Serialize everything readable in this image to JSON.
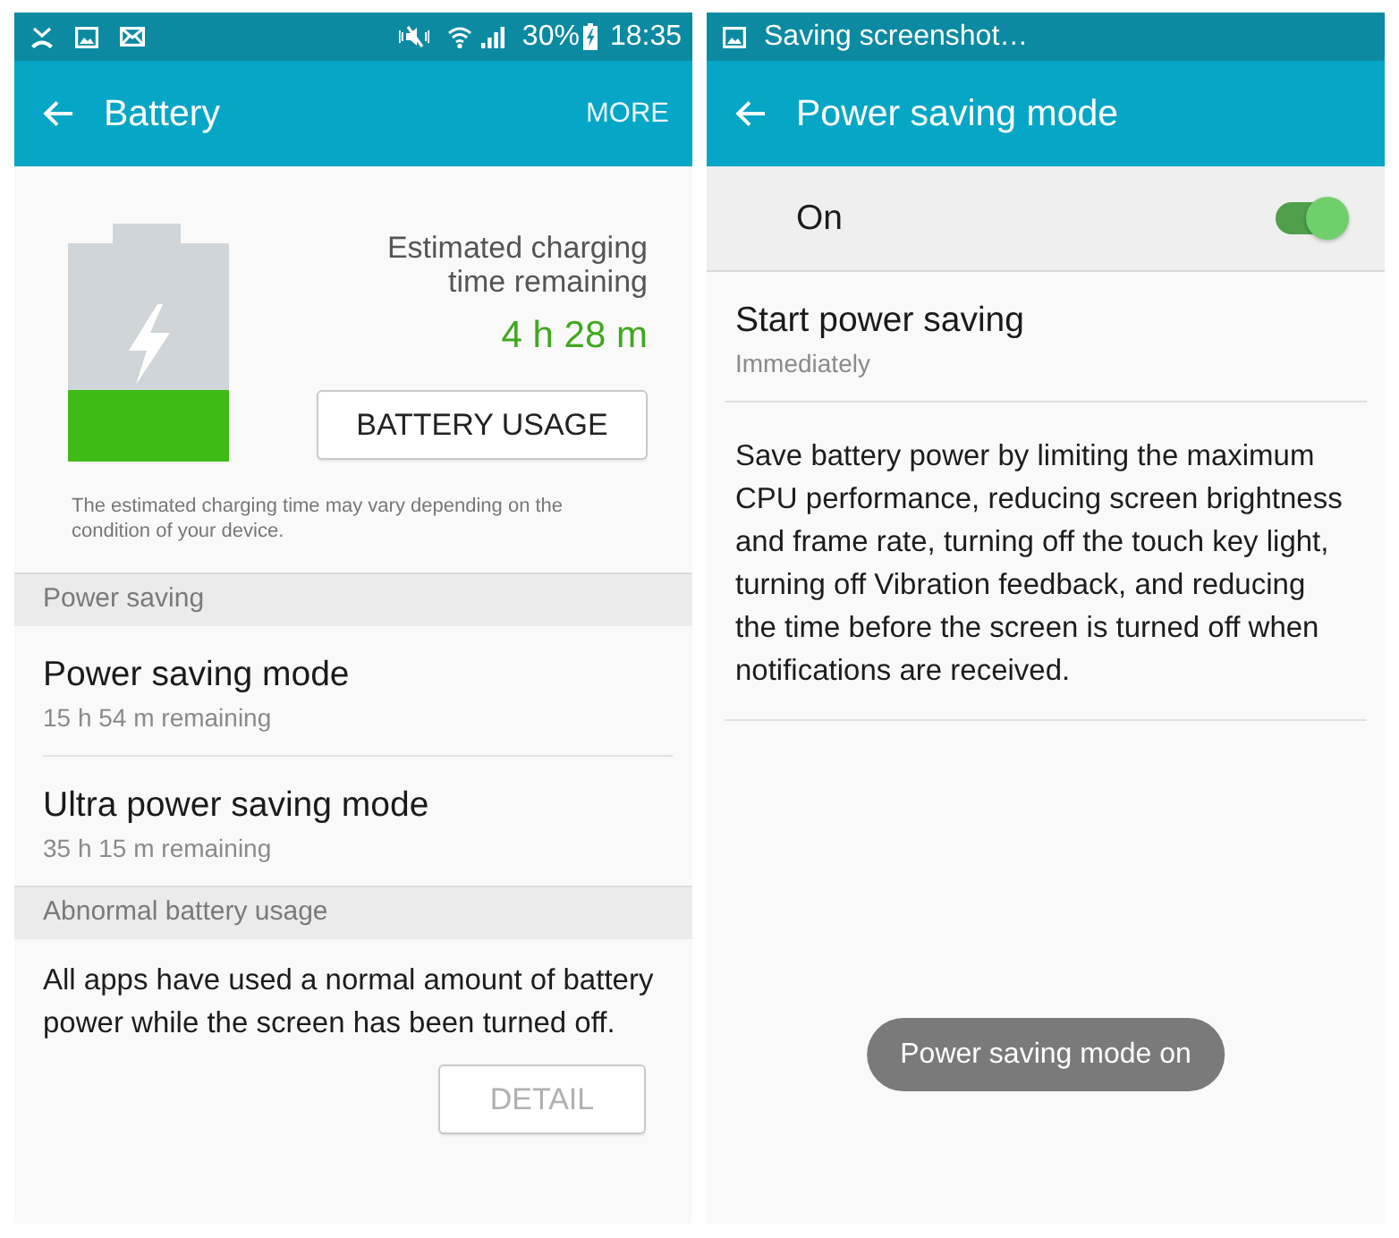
{
  "left_screen": {
    "status_bar": {
      "battery_percent": "30%",
      "time": "18:35"
    },
    "app_bar": {
      "title": "Battery",
      "action": "MORE"
    },
    "battery": {
      "level": 0.33,
      "charging": true,
      "estimate_label": "Estimated charging time remaining",
      "estimate_value": "4 h 28 m",
      "button": "BATTERY USAGE",
      "note": "The estimated charging time may vary depending on the condition of your device."
    },
    "sections": [
      {
        "kind": "list",
        "header": "Power saving",
        "items": [
          {
            "title": "Power saving mode",
            "subtitle": "15 h 54 m remaining"
          },
          {
            "title": "Ultra power saving mode",
            "subtitle": "35 h 15 m remaining"
          }
        ]
      },
      {
        "kind": "message",
        "header": "Abnormal battery usage",
        "text": "All apps have used a normal amount of battery power while the screen has been turned off.",
        "button": {
          "label": "DETAIL",
          "disabled": true
        }
      }
    ]
  },
  "right_screen": {
    "status_bar": {
      "notification": "Saving screenshot…"
    },
    "app_bar": {
      "title": "Power saving mode"
    },
    "master_switch": {
      "label": "On",
      "on": true
    },
    "items": [
      {
        "title": "Start power saving",
        "subtitle": "Immediately"
      }
    ],
    "description": "Save battery power by limiting the maximum CPU performance, reducing screen brightness and frame rate, turning off the touch key light, turning off Vibration feedback, and reducing the time before the screen is turned off when notifications are received.",
    "toast": "Power saving mode on"
  }
}
